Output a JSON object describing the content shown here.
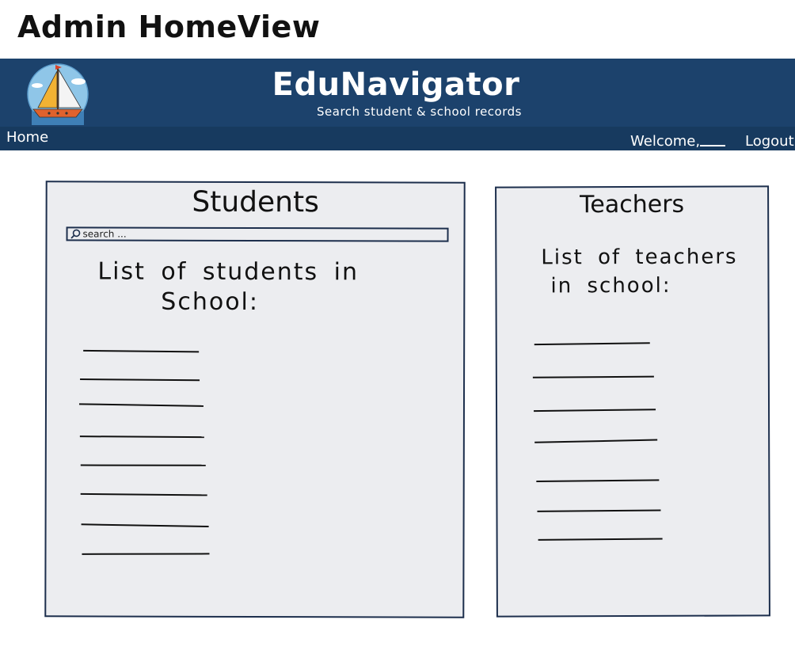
{
  "page_title": "Admin HomeView",
  "header": {
    "brand": "EduNavigator",
    "tagline": "Search student & school records",
    "logo_icon": "sailboat-icon"
  },
  "navbar": {
    "home_label": "Home",
    "welcome_label": "Welcome,",
    "logout_label": "Logout"
  },
  "students": {
    "title": "Students",
    "search": {
      "placeholder": "search ...",
      "icon": "search-icon",
      "value": ""
    },
    "caption_line1": "List of students in",
    "caption_line2": "School:",
    "placeholder_rows": 8
  },
  "teachers": {
    "title": "Teachers",
    "caption_line1": "List of teachers",
    "caption_line2": "in school:",
    "placeholder_rows": 7
  },
  "colors": {
    "header_bg": "#1c426c",
    "navbar_bg": "#173a5f",
    "panel_bg": "#ecedf0",
    "panel_border": "#1d2f4d"
  }
}
